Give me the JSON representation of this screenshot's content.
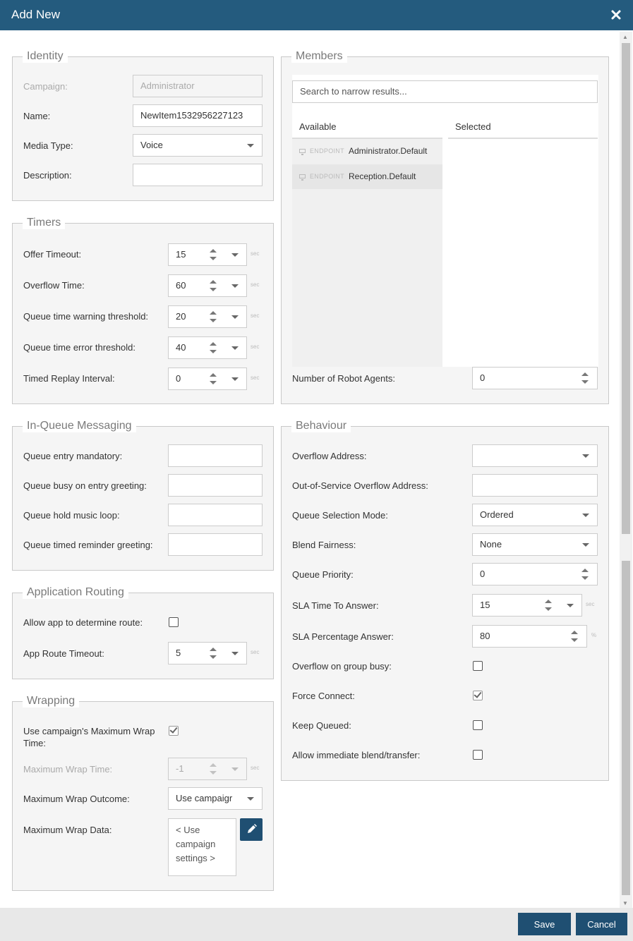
{
  "dialog": {
    "title": "Add New",
    "close_icon": "close-icon"
  },
  "identity": {
    "legend": "Identity",
    "campaign_label": "Campaign:",
    "campaign_value": "Administrator",
    "name_label": "Name:",
    "name_value": "NewItem1532956227123",
    "media_label": "Media Type:",
    "media_value": "Voice",
    "description_label": "Description:",
    "description_value": ""
  },
  "timers": {
    "legend": "Timers",
    "unit": "sec",
    "rows": [
      {
        "label": "Offer Timeout:",
        "value": "15"
      },
      {
        "label": "Overflow Time:",
        "value": "60"
      },
      {
        "label": "Queue time warning threshold:",
        "value": "20"
      },
      {
        "label": "Queue time error threshold:",
        "value": "40"
      },
      {
        "label": "Timed Replay Interval:",
        "value": "0"
      }
    ]
  },
  "messaging": {
    "legend": "In-Queue Messaging",
    "rows": [
      {
        "label": "Queue entry mandatory:",
        "value": ""
      },
      {
        "label": "Queue busy on entry greeting:",
        "value": ""
      },
      {
        "label": "Queue hold music loop:",
        "value": ""
      },
      {
        "label": "Queue timed reminder greeting:",
        "value": ""
      }
    ]
  },
  "routing": {
    "legend": "Application Routing",
    "allow_label": "Allow app to determine route:",
    "allow_checked": false,
    "timeout_label": "App Route Timeout:",
    "timeout_value": "5",
    "unit": "sec"
  },
  "wrapping": {
    "legend": "Wrapping",
    "use_max_label_line1": "Use campaign's Maximum Wrap",
    "use_max_label_line2": "Time:",
    "use_max_checked": true,
    "max_time_label": "Maximum Wrap Time:",
    "max_time_value": "-1",
    "unit": "sec",
    "outcome_label": "Maximum Wrap Outcome:",
    "outcome_value": "Use campaigr",
    "data_label": "Maximum Wrap Data:",
    "data_line1": "< Use",
    "data_line2": "campaign",
    "data_line3": "settings >"
  },
  "members": {
    "legend": "Members",
    "search_placeholder": "Search to narrow results...",
    "available_header": "Available",
    "selected_header": "Selected",
    "available": [
      {
        "tag": "ENDPOINT",
        "name": "Administrator.Default"
      },
      {
        "tag": "ENDPOINT",
        "name": "Reception.Default"
      }
    ],
    "robot_label": "Number of Robot Agents:",
    "robot_value": "0"
  },
  "behaviour": {
    "legend": "Behaviour",
    "overflow_address_label": "Overflow Address:",
    "overflow_address_value": "",
    "oos_label": "Out-of-Service Overflow Address:",
    "oos_value": "",
    "selection_mode_label": "Queue Selection Mode:",
    "selection_mode_value": "Ordered",
    "blend_label": "Blend Fairness:",
    "blend_value": "None",
    "priority_label": "Queue Priority:",
    "priority_value": "0",
    "sla_time_label": "SLA Time To Answer:",
    "sla_time_value": "15",
    "sla_time_unit": "sec",
    "sla_pct_label": "SLA Percentage Answer:",
    "sla_pct_value": "80",
    "sla_pct_unit": "%",
    "overflow_busy_label": "Overflow on group busy:",
    "overflow_busy_checked": false,
    "force_label": "Force Connect:",
    "force_checked": true,
    "keep_label": "Keep Queued:",
    "keep_checked": false,
    "blend_transfer_label": "Allow immediate blend/transfer:",
    "blend_transfer_checked": false
  },
  "footer": {
    "save_label": "Save",
    "cancel_label": "Cancel"
  },
  "colors": {
    "titlebar": "#245b7e",
    "button": "#1f4f72",
    "panel": "#f5f5f5"
  }
}
